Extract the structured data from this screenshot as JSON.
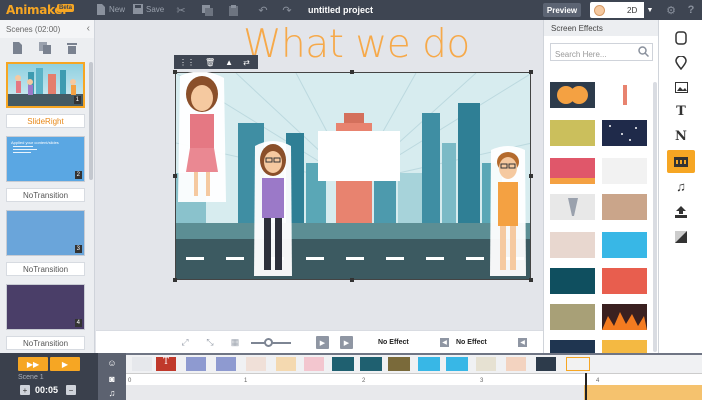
{
  "app": {
    "logo": "Animaker",
    "badge": "Beta",
    "project_title": "untitled project"
  },
  "toolbar": {
    "new_label": "New",
    "save_label": "Save",
    "preview_label": "Preview",
    "mode_value": "2D"
  },
  "scenes": {
    "header": "Scenes (02:00)",
    "items": [
      {
        "number": "1",
        "transition": "SlideRight",
        "active": true
      },
      {
        "number": "2",
        "transition": "NoTransition",
        "active": false,
        "text": "Applied your content/slides"
      },
      {
        "number": "3",
        "transition": "NoTransition",
        "active": false
      },
      {
        "number": "4",
        "transition": "NoTransition",
        "active": false
      }
    ]
  },
  "stage": {
    "headline": "What we do"
  },
  "bottom_controls": {
    "effect_in": "No Effect",
    "effect_out": "No Effect"
  },
  "effects_panel": {
    "title": "Screen Effects",
    "search_placeholder": "Search Here..."
  },
  "timeline": {
    "scene_label": "Scene 1",
    "duration": "00:05",
    "ruler_ticks": [
      "0",
      "1",
      "2",
      "3",
      "4"
    ]
  },
  "colors": {
    "accent": "#f6a623",
    "topbar": "#3e4552",
    "headline": "#f6a94a"
  },
  "icons": {
    "right_tools": [
      "character-icon",
      "location-pin-icon",
      "image-icon",
      "text-icon",
      "number-icon",
      "video-icon",
      "music-icon",
      "upload-icon",
      "background-icon"
    ]
  }
}
